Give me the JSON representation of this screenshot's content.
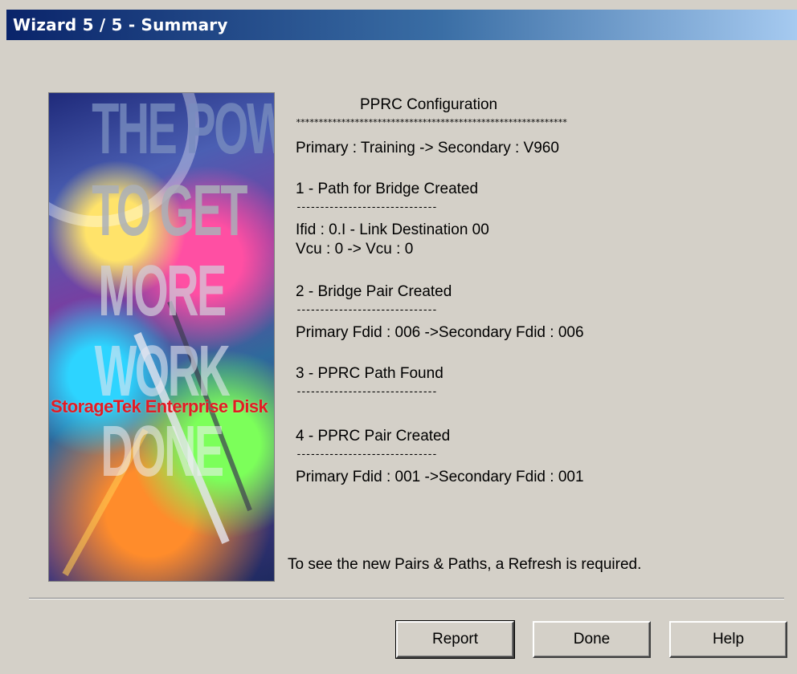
{
  "window": {
    "title": "Wizard 5 / 5 - Summary"
  },
  "banner": {
    "words": [
      "THE POWER",
      "TO GET",
      "MORE",
      "WORK",
      "DONE",
      ""
    ],
    "brand": "StorageTek Enterprise Disk",
    "brand_color": "#e31b23"
  },
  "summary": {
    "heading": "PPRC Configuration",
    "stars": "************************************************************",
    "connection": "Primary : Training -> Secondary : V960",
    "steps": [
      {
        "title": "1 - Path for Bridge Created",
        "divider": "------------------------------",
        "details": [
          "Ifid : 0.I - Link Destination 00",
          "Vcu : 0 -> Vcu : 0"
        ]
      },
      {
        "title": "2 - Bridge Pair Created",
        "divider": "------------------------------",
        "details": [
          "Primary Fdid : 006 ->Secondary Fdid : 006"
        ]
      },
      {
        "title": "3 - PPRC Path Found",
        "divider": "------------------------------",
        "details": []
      },
      {
        "title": "4 - PPRC Pair Created",
        "divider": "------------------------------",
        "details": [
          "Primary Fdid : 001 ->Secondary Fdid : 001"
        ]
      }
    ]
  },
  "note": "To see the new Pairs & Paths, a Refresh is required.",
  "buttons": {
    "report": "Report",
    "done": "Done",
    "help": "Help"
  },
  "colors": {
    "titlebar_start": "#0a246a",
    "titlebar_end": "#a6caf0",
    "dialog_bg": "#d4d0c8"
  }
}
